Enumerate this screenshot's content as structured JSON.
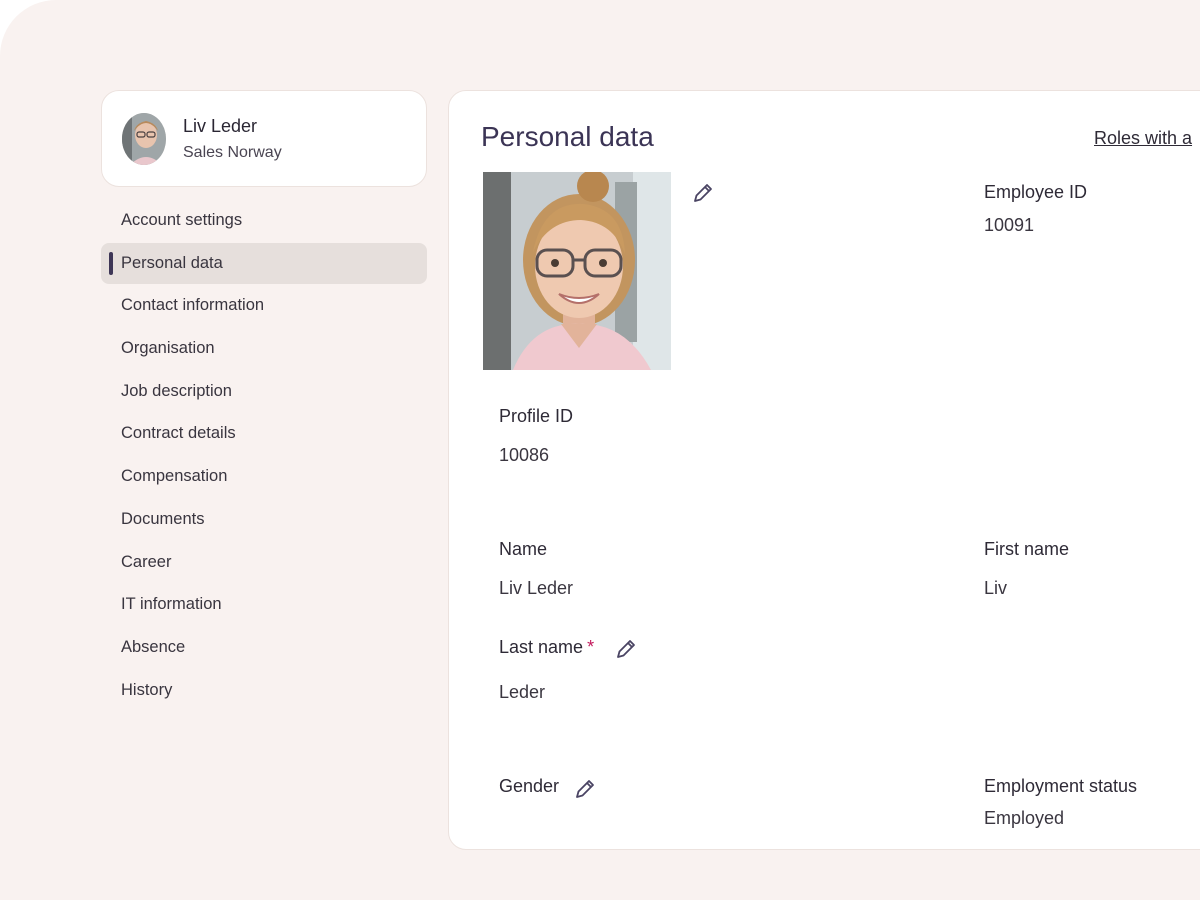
{
  "profile": {
    "name": "Liv Leder",
    "department": "Sales Norway"
  },
  "sidebar": {
    "items": [
      {
        "label": "Account settings"
      },
      {
        "label": "Personal data"
      },
      {
        "label": "Contact information"
      },
      {
        "label": "Organisation"
      },
      {
        "label": "Job description"
      },
      {
        "label": "Contract details"
      },
      {
        "label": "Compensation"
      },
      {
        "label": "Documents"
      },
      {
        "label": "Career"
      },
      {
        "label": "IT information"
      },
      {
        "label": "Absence"
      },
      {
        "label": "History"
      }
    ],
    "active_index": 1
  },
  "main": {
    "title": "Personal data",
    "roles_link": "Roles with a",
    "fields": {
      "employee_id": {
        "label": "Employee ID",
        "value": "10091"
      },
      "profile_id": {
        "label": "Profile ID",
        "value": "10086"
      },
      "name": {
        "label": "Name",
        "value": "Liv Leder"
      },
      "first_name": {
        "label": "First name",
        "value": "Liv"
      },
      "last_name": {
        "label": "Last name",
        "required_mark": "*",
        "value": "Leder"
      },
      "gender": {
        "label": "Gender"
      },
      "employment_status": {
        "label": "Employment status",
        "value": "Employed"
      }
    }
  },
  "colors": {
    "app_background": "#f9f2f0",
    "accent": "#3e3656",
    "title": "#3b3455",
    "required": "#c2185b",
    "active_nav": "#e6dfdc"
  },
  "icons": {
    "edit": "pencil-icon",
    "avatar": "user-photo-icon"
  }
}
